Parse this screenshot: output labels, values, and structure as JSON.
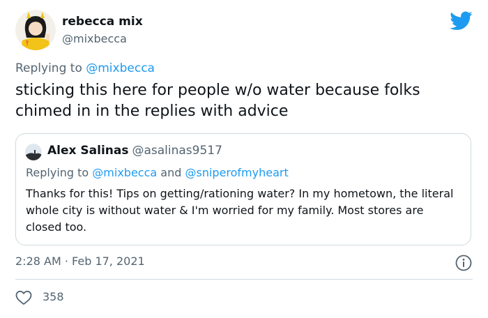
{
  "author": {
    "display_name": "rebecca mix",
    "handle": "@mixbecca"
  },
  "reply_context": {
    "prefix": "Replying to ",
    "handle": "@mixbecca"
  },
  "tweet_text": "sticking this here for people w/o water because folks chimed in in the replies with advice",
  "quoted_tweet": {
    "display_name": "Alex Salinas",
    "handle": "@asalinas9517",
    "reply_prefix": "Replying to ",
    "reply_handle_1": "@mixbecca",
    "reply_and": " and ",
    "reply_handle_2": "@sniperofmyheart",
    "text": "Thanks for this! Tips on getting/rationing water? In my hometown, the literal whole city is without water & I'm worried for my family. Most stores are closed too."
  },
  "timestamp": "2:28 AM · Feb 17, 2021",
  "likes": "358",
  "icons": {
    "logo": "twitter-bird-icon",
    "info": "info-icon",
    "like": "heart-icon"
  },
  "colors": {
    "brand": "#1d9bf0",
    "text": "#0f1419",
    "muted": "#536471",
    "border": "#cfd9de"
  }
}
